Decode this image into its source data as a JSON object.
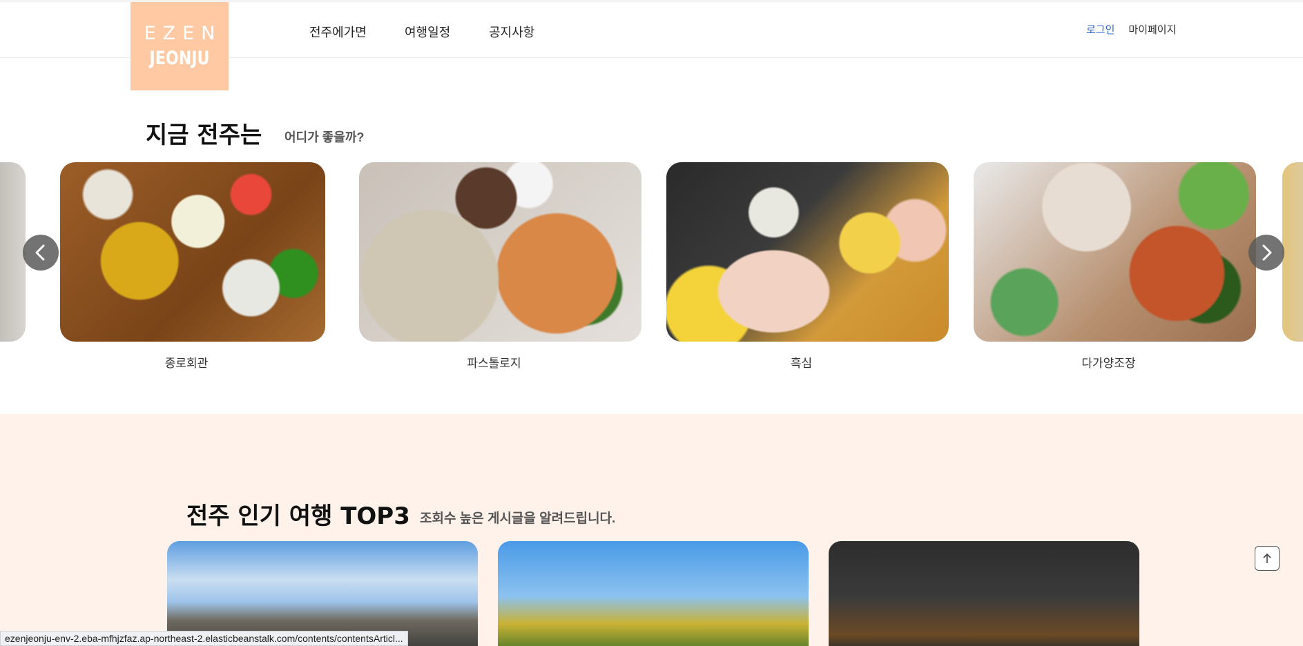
{
  "header": {
    "logo_line1": "EZEN",
    "logo_line2": "JEONJU",
    "nav": [
      "전주에가면",
      "여행일정",
      "공지사항"
    ],
    "login": "로그인",
    "mypage": "마이페이지"
  },
  "recommend": {
    "title": "지금 전주는",
    "subtitle": "어디가 좋을까?",
    "items": [
      "종로회관",
      "파스톨로지",
      "흑심",
      "다가양조장"
    ]
  },
  "top3": {
    "title": "전주 인기 여행 TOP3",
    "subtitle": "조회수 높은 게시글을 알려드립니다."
  },
  "status_url": "ezenjeonju-env-2.eba-mfhjzfaz.ap-northeast-2.elasticbeanstalk.com/contents/contentsArticl...",
  "colors": {
    "logo_bg": "#ffcaa3",
    "section_bg": "#fff2ea",
    "login": "#2a5fd1"
  }
}
